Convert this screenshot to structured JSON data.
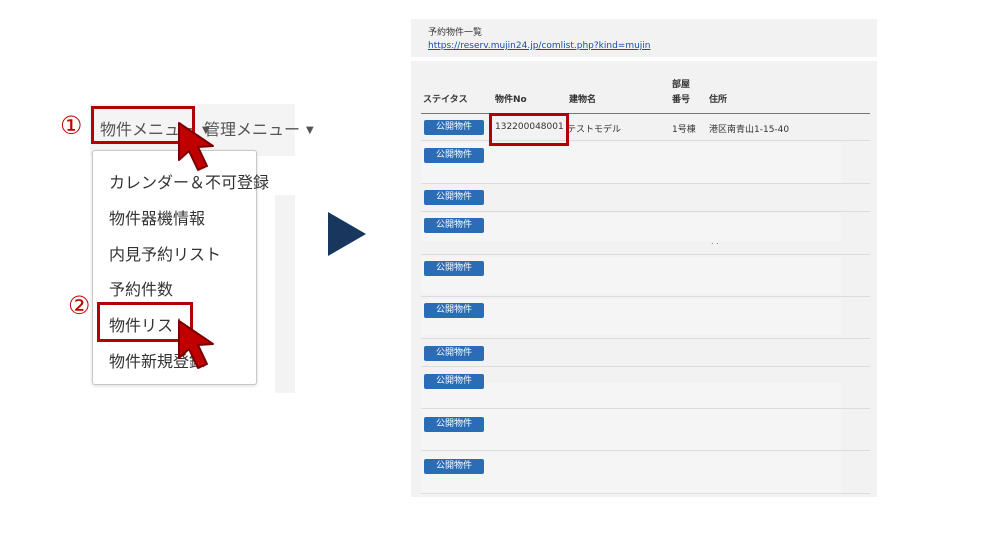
{
  "steps": {
    "one": "①",
    "two": "②"
  },
  "menubar": {
    "property_menu": "物件メニュー",
    "admin_menu": "管理メニュー",
    "caret": "▼"
  },
  "dropdown": {
    "items": [
      "カレンダー＆不可登録",
      "物件器機情報",
      "内見予約リスト",
      "予約件数",
      "物件リスト",
      "物件新規登録"
    ]
  },
  "screenshot": {
    "title": "予約物件一覧",
    "url": "https://reserv.mujin24.jp/comlist.php?kind=mujin",
    "columns": {
      "status": "ステイタス",
      "property_no": "物件No",
      "building": "建物名",
      "room_1": "部屋",
      "room_2": "番号",
      "address": "住所"
    },
    "badge_label": "公開物件",
    "first_row": {
      "property_no": "132200048001",
      "building": "テストモデル",
      "room": "1号棟",
      "address": "港区南青山1-15-40"
    },
    "dots": ". ."
  },
  "colors": {
    "highlight": "#b30000",
    "badge": "#2b6cb7",
    "arrow": "#17375e",
    "link": "#1a4bb0"
  }
}
